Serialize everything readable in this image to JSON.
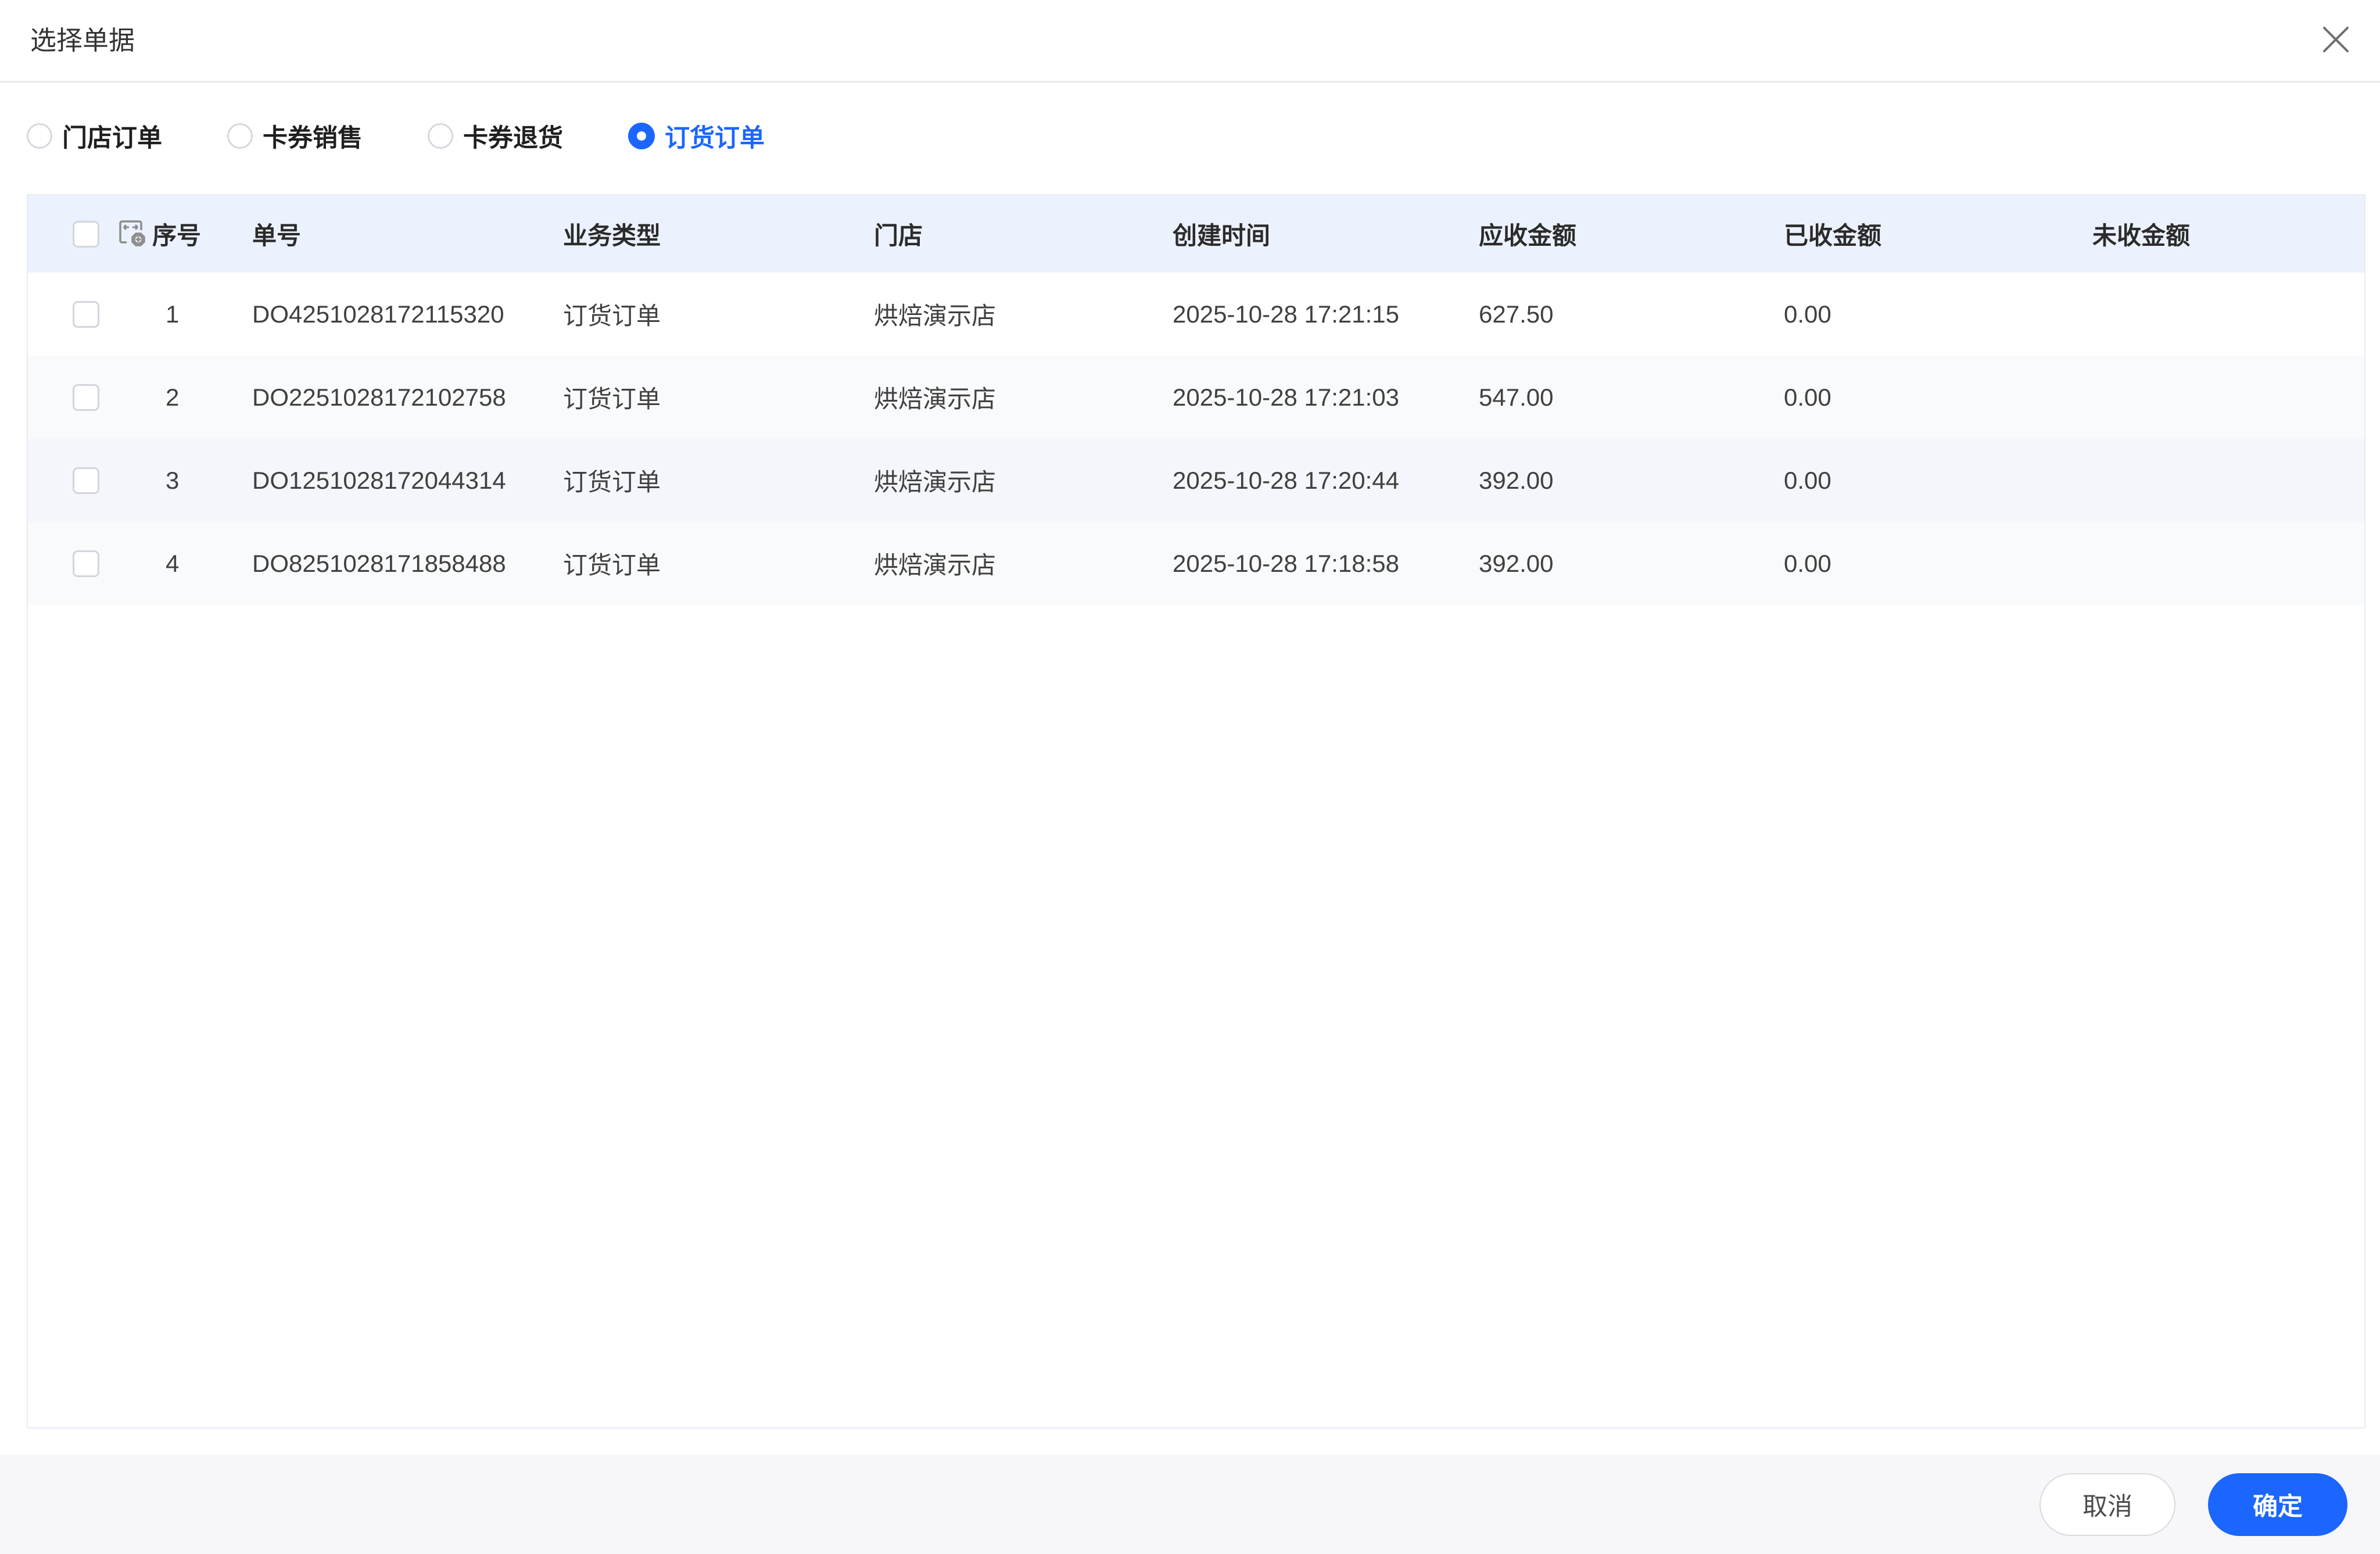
{
  "dialog": {
    "title": "选择单据"
  },
  "icons": {
    "close": "close-icon",
    "column_settings": "column-settings-icon"
  },
  "colors": {
    "accent_blue": "#1a66ff",
    "table_header_bg": "#ecf2fd",
    "footer_bg": "#f7f7f9"
  },
  "radio_group": {
    "items": [
      {
        "label": "门店订单",
        "selected": false
      },
      {
        "label": "卡券销售",
        "selected": false
      },
      {
        "label": "卡券退货",
        "selected": false
      },
      {
        "label": "订货订单",
        "selected": true
      }
    ]
  },
  "table": {
    "columns": {
      "index": "序号",
      "order_no": "单号",
      "business_type": "业务类型",
      "store": "门店",
      "created_at": "创建时间",
      "receivable": "应收金额",
      "received": "已收金额",
      "unreceived": "未收金额"
    },
    "rows": [
      {
        "index": "1",
        "order_no": "DO4251028172115320",
        "business_type": "订货订单",
        "store": "烘焙演示店",
        "created_at": "2025-10-28 17:21:15",
        "receivable": "627.50",
        "received": "0.00",
        "unreceived": ""
      },
      {
        "index": "2",
        "order_no": "DO2251028172102758",
        "business_type": "订货订单",
        "store": "烘焙演示店",
        "created_at": "2025-10-28 17:21:03",
        "receivable": "547.00",
        "received": "0.00",
        "unreceived": ""
      },
      {
        "index": "3",
        "order_no": "DO1251028172044314",
        "business_type": "订货订单",
        "store": "烘焙演示店",
        "created_at": "2025-10-28 17:20:44",
        "receivable": "392.00",
        "received": "0.00",
        "unreceived": ""
      },
      {
        "index": "4",
        "order_no": "DO8251028171858488",
        "business_type": "订货订单",
        "store": "烘焙演示店",
        "created_at": "2025-10-28 17:18:58",
        "receivable": "392.00",
        "received": "0.00",
        "unreceived": ""
      }
    ]
  },
  "footer": {
    "cancel_label": "取消",
    "confirm_label": "确定"
  }
}
